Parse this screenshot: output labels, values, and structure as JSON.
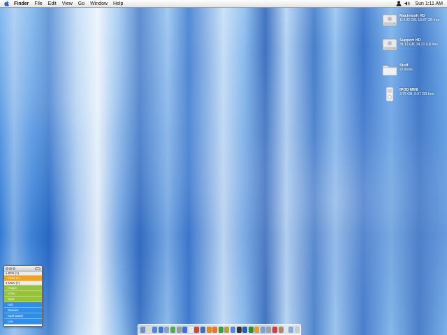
{
  "menubar": {
    "app_name": "Finder",
    "items": [
      "File",
      "Edit",
      "View",
      "Go",
      "Window",
      "Help"
    ],
    "clock": "Sun 1:11 AM"
  },
  "desktop_icons": [
    {
      "name": "Macintosh HD",
      "detail": "114.92 GB, 19.87 GB free",
      "icon": "hard-drive-icon"
    },
    {
      "name": "Support HD",
      "detail": "38.13 GB, 34.31 GB free",
      "icon": "hard-drive-icon"
    },
    {
      "name": "Stuff",
      "detail": "22 items",
      "icon": "folder-icon"
    },
    {
      "name": "IPOD MINI",
      "detail": "3.75 GB, 0.97 GB free",
      "icon": "ipod-icon"
    }
  ],
  "buddy_list": {
    "groups": [
      {
        "label": "▾ BFB (1)",
        "color": "orange",
        "buddies": [
          "Chris Lo"
        ]
      },
      {
        "label": "▾ MSN (7)",
        "color": "green",
        "buddies": [
          "Angus",
          "Chris",
          "Nate"
        ]
      },
      {
        "label": "",
        "color": "blue",
        "buddies": [
          "Adz",
          "Damien",
          "Kael David",
          "Leo"
        ]
      }
    ]
  },
  "colors": {
    "orange": "#f3a21e",
    "green": "#97c33a",
    "blue": "#2f8ee8"
  },
  "dock": {
    "icons": [
      "finder-icon",
      "dashboard-icon",
      "mail-icon",
      "safari-icon",
      "ichat-icon",
      "adium-icon",
      "calculator-icon",
      "itunes-icon",
      "textedit-icon",
      "preview-icon",
      "photoshop-icon",
      "illustrator-icon",
      "firefox-icon",
      "azureus-icon",
      "transmit-icon",
      "xcode-icon",
      "terminal-icon",
      "word-icon",
      "excel-icon",
      "keynote-icon",
      "quicktime-icon",
      "system-preferences-icon",
      "calendar-icon",
      "address-book-icon",
      "folder-icon",
      "trash-icon"
    ]
  }
}
